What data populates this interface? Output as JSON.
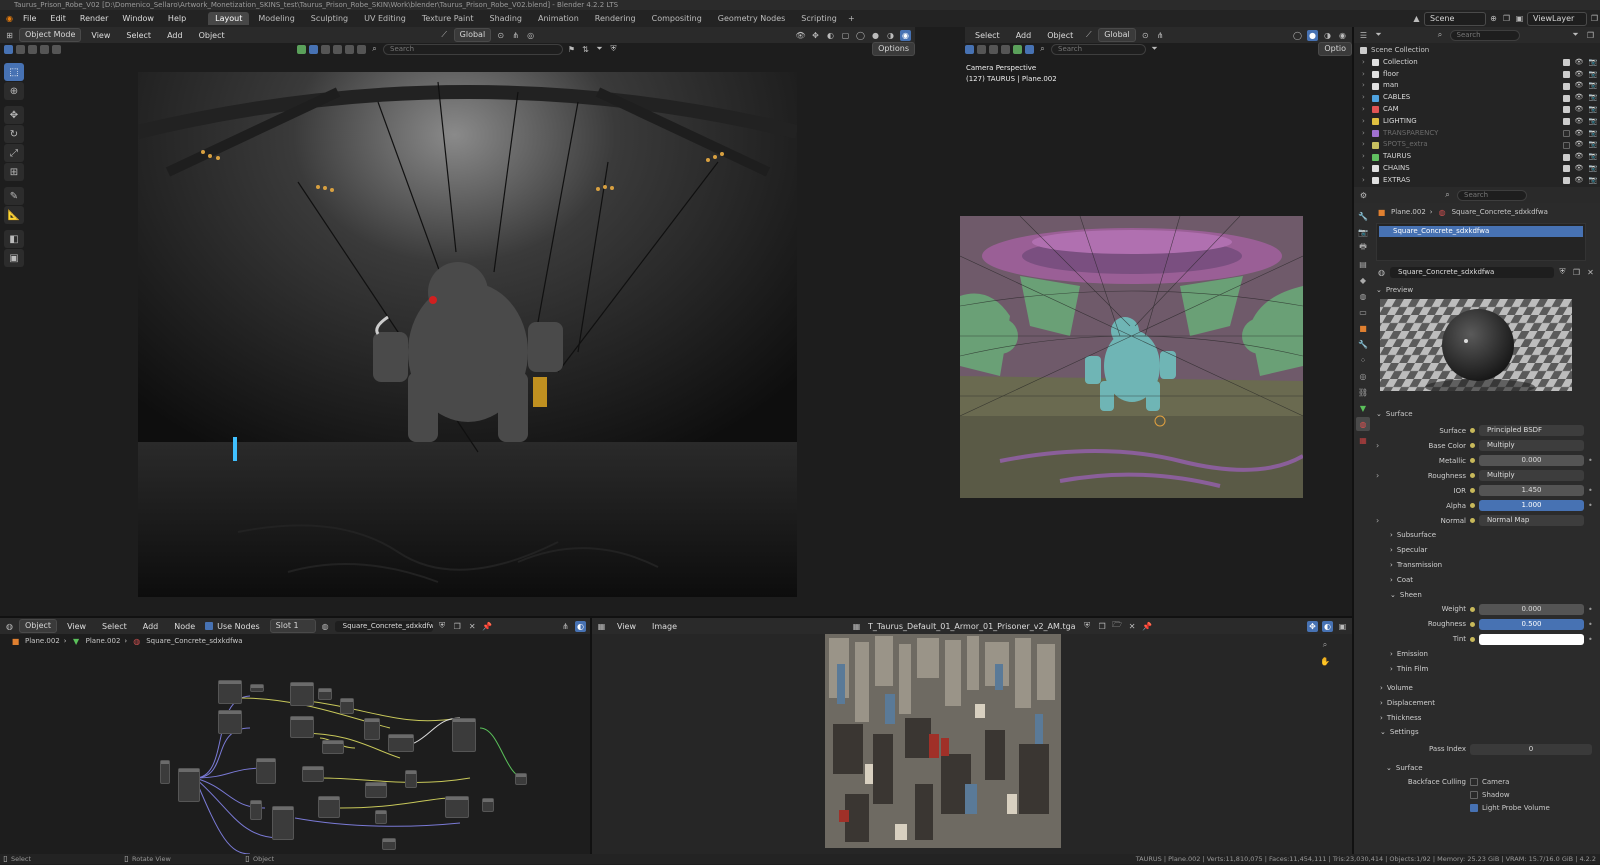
{
  "title": "Taurus_Prison_Robe_V02 [D:\\Domenico_Sellaro\\Artwork_Monetization_SKINS_test\\Taurus_Prison_Robe_SKIN\\Work\\blender\\Taurus_Prison_Robe_V02.blend] - Blender 4.2.2 LTS",
  "menu": [
    "File",
    "Edit",
    "Render",
    "Window",
    "Help"
  ],
  "workspaces": [
    "Layout",
    "Modeling",
    "Sculpting",
    "UV Editing",
    "Texture Paint",
    "Shading",
    "Animation",
    "Rendering",
    "Compositing",
    "Geometry Nodes",
    "Scripting"
  ],
  "scene": {
    "label": "Scene",
    "view_layer": "ViewLayer"
  },
  "viewport_left": {
    "mode": "Object Mode",
    "menus": [
      "View",
      "Select",
      "Add",
      "Object"
    ],
    "transform": "Global",
    "search_placeholder": "Search",
    "options": "Options"
  },
  "viewport_right": {
    "menus": [
      "Select",
      "Add",
      "Object"
    ],
    "transform": "Global",
    "search_placeholder": "Search",
    "options": "Optio",
    "overlay_line1": "Camera Perspective",
    "overlay_line2": "(127) TAURUS | Plane.002"
  },
  "outliner": {
    "search_placeholder": "Search",
    "root": "Scene Collection",
    "items": [
      {
        "name": "Collection",
        "color": "#e0e0e0",
        "dim": false
      },
      {
        "name": "floor",
        "color": "#e0e0e0",
        "dim": false
      },
      {
        "name": "man",
        "color": "#e0e0e0",
        "dim": false
      },
      {
        "name": "CABLES",
        "color": "#4fa3e0",
        "dim": false
      },
      {
        "name": "CAM",
        "color": "#e05454",
        "dim": false
      },
      {
        "name": "LIGHTING",
        "color": "#e0c040",
        "dim": false
      },
      {
        "name": "TRANSPARENCY",
        "color": "#a070d0",
        "dim": true
      },
      {
        "name": "SPOTS_extra",
        "color": "#c8c060",
        "dim": true
      },
      {
        "name": "TAURUS",
        "color": "#60c060",
        "dim": false
      },
      {
        "name": "CHAINS",
        "color": "#e0e0e0",
        "dim": false
      },
      {
        "name": "EXTRAS",
        "color": "#e0e0e0",
        "dim": false
      }
    ]
  },
  "properties": {
    "search_placeholder": "Search",
    "breadcrumb_object": "Plane.002",
    "breadcrumb_material": "Square_Concrete_sdxkdfwa",
    "slot_name": "Square_Concrete_sdxkdfwa",
    "material_name": "Square_Concrete_sdxkdfwa",
    "preview_label": "Preview",
    "surface_section": "Surface",
    "rows": [
      {
        "label": "Surface",
        "value": "Principled BSDF",
        "kind": "link"
      },
      {
        "label": "Base Color",
        "value": "Multiply",
        "kind": "link",
        "arrow": true
      },
      {
        "label": "Metallic",
        "value": "0.000",
        "kind": "num"
      },
      {
        "label": "Roughness",
        "value": "Multiply",
        "kind": "link",
        "arrow": true
      },
      {
        "label": "IOR",
        "value": "1.450",
        "kind": "num"
      },
      {
        "label": "Alpha",
        "value": "1.000",
        "kind": "blue"
      },
      {
        "label": "Normal",
        "value": "Normal Map",
        "kind": "link",
        "arrow": true
      }
    ],
    "subsections": [
      "Subsurface",
      "Specular",
      "Transmission",
      "Coat"
    ],
    "sheen": "Sheen",
    "sheen_rows": [
      {
        "label": "Weight",
        "value": "0.000",
        "kind": "num"
      },
      {
        "label": "Roughness",
        "value": "0.500",
        "kind": "blue"
      },
      {
        "label": "Tint",
        "value": "",
        "kind": "white"
      }
    ],
    "more_subsections": [
      "Emission",
      "Thin Film"
    ],
    "panels": [
      "Volume",
      "Displacement",
      "Thickness"
    ],
    "settings": "Settings",
    "pass_index_label": "Pass Index",
    "pass_index_value": "0",
    "settings_surface": "Surface",
    "backface_culling": "Backface Culling",
    "camera": "Camera",
    "shadow": "Shadow",
    "light_probe": "Light Probe Volume"
  },
  "node_editor": {
    "editor_type": "Object",
    "menus": [
      "View",
      "Select",
      "Add",
      "Node"
    ],
    "use_nodes": "Use Nodes",
    "slot": "Slot 1",
    "material": "Square_Concrete_sdxkdfwa",
    "breadcrumb": [
      "Plane.002",
      "Plane.002",
      "Square_Concrete_sdxkdfwa"
    ]
  },
  "image_editor": {
    "menus": [
      "View",
      "Image"
    ],
    "image_name": "T_Taurus_Default_01_Armor_01_Prisoner_v2_AM.tga"
  },
  "status": {
    "left": [
      "Select",
      "Rotate View",
      "Object"
    ],
    "right": "TAURUS | Plane.002 | Verts:11,810,075 | Faces:11,454,111 | Tris:23,030,414 | Objects:1/92 | Memory: 25.23 GiB | VRAM: 15.7/16.0 GiB | 4.2.2"
  }
}
